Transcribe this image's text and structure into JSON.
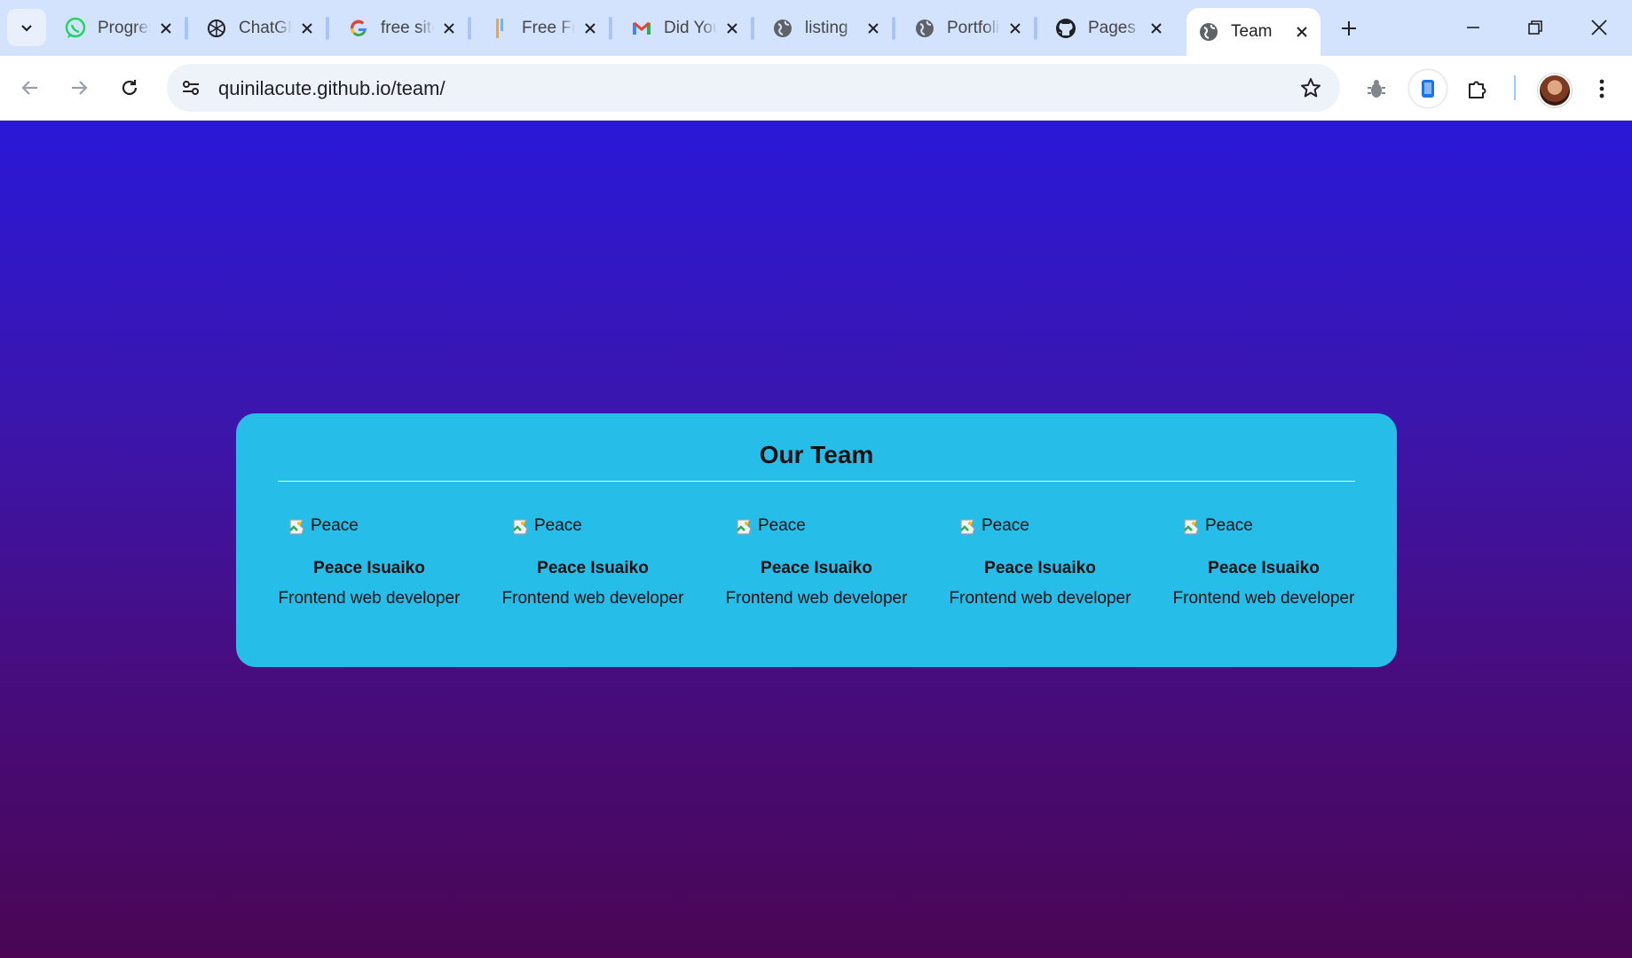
{
  "browser": {
    "tabs": [
      {
        "title": "Progress",
        "icon": "whatsapp-icon",
        "active": false
      },
      {
        "title": "ChatGPT",
        "icon": "chatgpt-icon",
        "active": false
      },
      {
        "title": "free site",
        "icon": "google-icon",
        "active": false
      },
      {
        "title": "Free Frontend",
        "icon": "bookmark-stripe-icon",
        "active": false
      },
      {
        "title": "Did You",
        "icon": "gmail-icon",
        "active": false
      },
      {
        "title": "listing",
        "icon": "globe-icon",
        "active": false
      },
      {
        "title": "Portfolio",
        "icon": "globe-icon",
        "active": false
      },
      {
        "title": "Pages",
        "icon": "github-icon",
        "active": false
      },
      {
        "title": "Team",
        "icon": "globe-icon",
        "active": true
      }
    ],
    "url": "quinilacute.github.io/team/"
  },
  "page": {
    "heading": "Our Team",
    "members": [
      {
        "image_alt": "Peace",
        "name": "Peace Isuaiko",
        "role": "Frontend web developer"
      },
      {
        "image_alt": "Peace",
        "name": "Peace Isuaiko",
        "role": "Frontend web developer"
      },
      {
        "image_alt": "Peace",
        "name": "Peace Isuaiko",
        "role": "Frontend web developer"
      },
      {
        "image_alt": "Peace",
        "name": "Peace Isuaiko",
        "role": "Frontend web developer"
      },
      {
        "image_alt": "Peace",
        "name": "Peace Isuaiko",
        "role": "Frontend web developer"
      }
    ]
  },
  "colors": {
    "card": "#26bde9",
    "gradient_top": "#2a18d8",
    "gradient_bottom": "#4a0654",
    "tabstrip": "#d3e3fd"
  }
}
